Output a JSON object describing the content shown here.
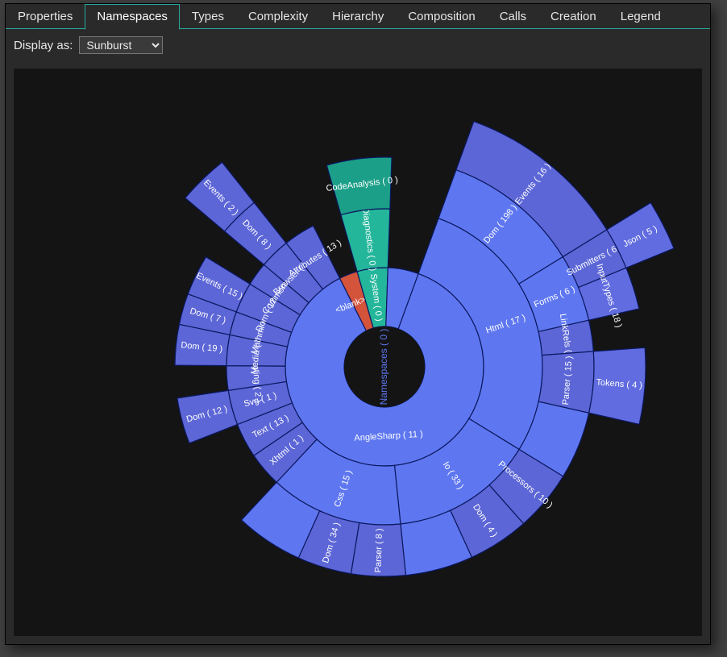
{
  "tabs": {
    "items": [
      {
        "label": "Properties"
      },
      {
        "label": "Namespaces"
      },
      {
        "label": "Types"
      },
      {
        "label": "Complexity"
      },
      {
        "label": "Hierarchy"
      },
      {
        "label": "Composition"
      },
      {
        "label": "Calls"
      },
      {
        "label": "Creation"
      },
      {
        "label": "Legend"
      }
    ],
    "active_index": 1
  },
  "display": {
    "label": "Display as:",
    "selected": "Sunburst",
    "options": [
      "Sunburst"
    ]
  },
  "colors": {
    "root": "#5e77f0",
    "purple": "#5c66d6",
    "purple2": "#616ce0",
    "green": "#24b69b",
    "green2": "#1c9f88",
    "orange": "#d3533b"
  },
  "chart_data": {
    "type": "sunburst",
    "title": "",
    "center_label": "Namespaces ( 0 )",
    "root": {
      "name": "Namespaces",
      "value": 0,
      "children": [
        {
          "name": "AngleSharp",
          "value": 11,
          "weight": 87,
          "color": "root",
          "children": [
            {
              "name": "Html",
              "value": 17,
              "weight": 27,
              "color": "root",
              "children": [
                {
                  "name": "Dom",
                  "value": 198,
                  "weight": 10.2,
                  "color": "root",
                  "children": [
                    {
                      "name": "Events",
                      "value": 16,
                      "weight": 10.2,
                      "extend": true,
                      "color": "purple"
                    }
                  ]
                },
                {
                  "name": "Forms",
                  "value": 6,
                  "weight": 5,
                  "color": "root",
                  "children": [
                    {
                      "name": "Submitters",
                      "value": 6,
                      "weight": 2.5,
                      "extend": true,
                      "color": "purple",
                      "children": [
                        {
                          "name": "Json",
                          "value": 5,
                          "weight": 2.5,
                          "extend": true,
                          "color": "purple2"
                        }
                      ]
                    },
                    {
                      "name": "InputTypes",
                      "value": 18,
                      "weight": 2.5,
                      "extend": true,
                      "color": "purple2",
                      "radial": true
                    }
                  ]
                },
                {
                  "name": "LinkRels",
                  "value": 3,
                  "weight": 2.3,
                  "color": "purple",
                  "radial": true
                },
                {
                  "name": "Parser",
                  "value": 15,
                  "weight": 4.5,
                  "color": "purple",
                  "radial": true,
                  "children": [
                    {
                      "name": "Tokens",
                      "value": 4,
                      "weight": 4.5,
                      "extend": true,
                      "color": "purple2"
                    }
                  ]
                },
                {
                  "name": "",
                  "value": 0,
                  "weight": 5.0,
                  "color": "root",
                  "blank": true
                }
              ]
            },
            {
              "name": "Io",
              "value": 33,
              "weight": 14,
              "color": "root",
              "children": [
                {
                  "name": "Processors",
                  "value": 10,
                  "weight": 4.5,
                  "color": "purple"
                },
                {
                  "name": "Dom",
                  "value": 4,
                  "weight": 4.5,
                  "color": "purple"
                },
                {
                  "name": "",
                  "value": 0,
                  "weight": 5.0,
                  "color": "root",
                  "blank": true
                }
              ]
            },
            {
              "name": "Css",
              "value": 15,
              "weight": 13,
              "color": "root",
              "children": [
                {
                  "name": "Parser",
                  "value": 8,
                  "weight": 4.0,
                  "extend": true,
                  "color": "purple"
                },
                {
                  "name": "Dom",
                  "value": 34,
                  "weight": 4.0,
                  "extend": true,
                  "color": "purple"
                },
                {
                  "name": "",
                  "value": 0,
                  "weight": 5.0,
                  "color": "root",
                  "blank": true
                }
              ]
            },
            {
              "name": "Xhtml",
              "value": 1,
              "weight": 3.4,
              "color": "purple"
            },
            {
              "name": "Text",
              "value": 13,
              "weight": 3.4,
              "color": "purple"
            },
            {
              "name": "Svg",
              "value": 1,
              "weight": 3.4,
              "color": "purple",
              "children": [
                {
                  "name": "Dom",
                  "value": 12,
                  "weight": 3.4,
                  "extend": true,
                  "color": "purple"
                }
              ]
            },
            {
              "name": "Scripting",
              "value": 2,
              "weight": 2.4,
              "radial": true,
              "color": "purple"
            },
            {
              "name": "Media",
              "value": 7,
              "weight": 3.0,
              "radial": true,
              "color": "purple",
              "children": [
                {
                  "name": "Dom",
                  "value": 19,
                  "weight": 3.0,
                  "extend": true,
                  "color": "purple"
                }
              ]
            },
            {
              "name": "Mathml",
              "value": 1,
              "weight": 2.3,
              "radial": true,
              "color": "purple",
              "children": [
                {
                  "name": "Dom",
                  "value": 7,
                  "weight": 2.3,
                  "extend": true,
                  "color": "purple"
                }
              ]
            },
            {
              "name": "Dom",
              "value": 123,
              "weight": 3.0,
              "radial": true,
              "color": "purple",
              "children": [
                {
                  "name": "Events",
                  "value": 15,
                  "weight": 3.0,
                  "extend": true,
                  "color": "purple"
                }
              ]
            },
            {
              "name": "Common",
              "value": 6,
              "weight": 2.3,
              "radial": true,
              "color": "purple"
            },
            {
              "name": "Browser",
              "value": 15,
              "weight": 3.0,
              "radial": true,
              "color": "purple",
              "children": [
                {
                  "name": "Dom",
                  "value": 8,
                  "weight": 3.0,
                  "extend": true,
                  "color": "purple",
                  "children": [
                    {
                      "name": "Events",
                      "value": 2,
                      "weight": 3.0,
                      "extend": true,
                      "color": "purple"
                    }
                  ]
                }
              ]
            },
            {
              "name": "Attributes",
              "value": 13,
              "weight": 3.1,
              "radial": true,
              "color": "purple"
            }
          ]
        },
        {
          "name": "<blank>",
          "value": 1,
          "weight": 3,
          "color": "orange",
          "radial": true
        },
        {
          "name": "System",
          "value": 0,
          "weight": 5,
          "color": "green",
          "children": [
            {
              "name": "Diagnostics",
              "value": 0,
              "weight": 5,
              "color": "green",
              "children": [
                {
                  "name": "CodeAnalysis",
                  "value": 0,
                  "weight": 5,
                  "extend": true,
                  "color": "green2",
                  "radial": true
                }
              ]
            }
          ]
        },
        {
          "name": "",
          "value": 0,
          "weight": 5,
          "blank": true,
          "color": "root"
        }
      ]
    }
  }
}
